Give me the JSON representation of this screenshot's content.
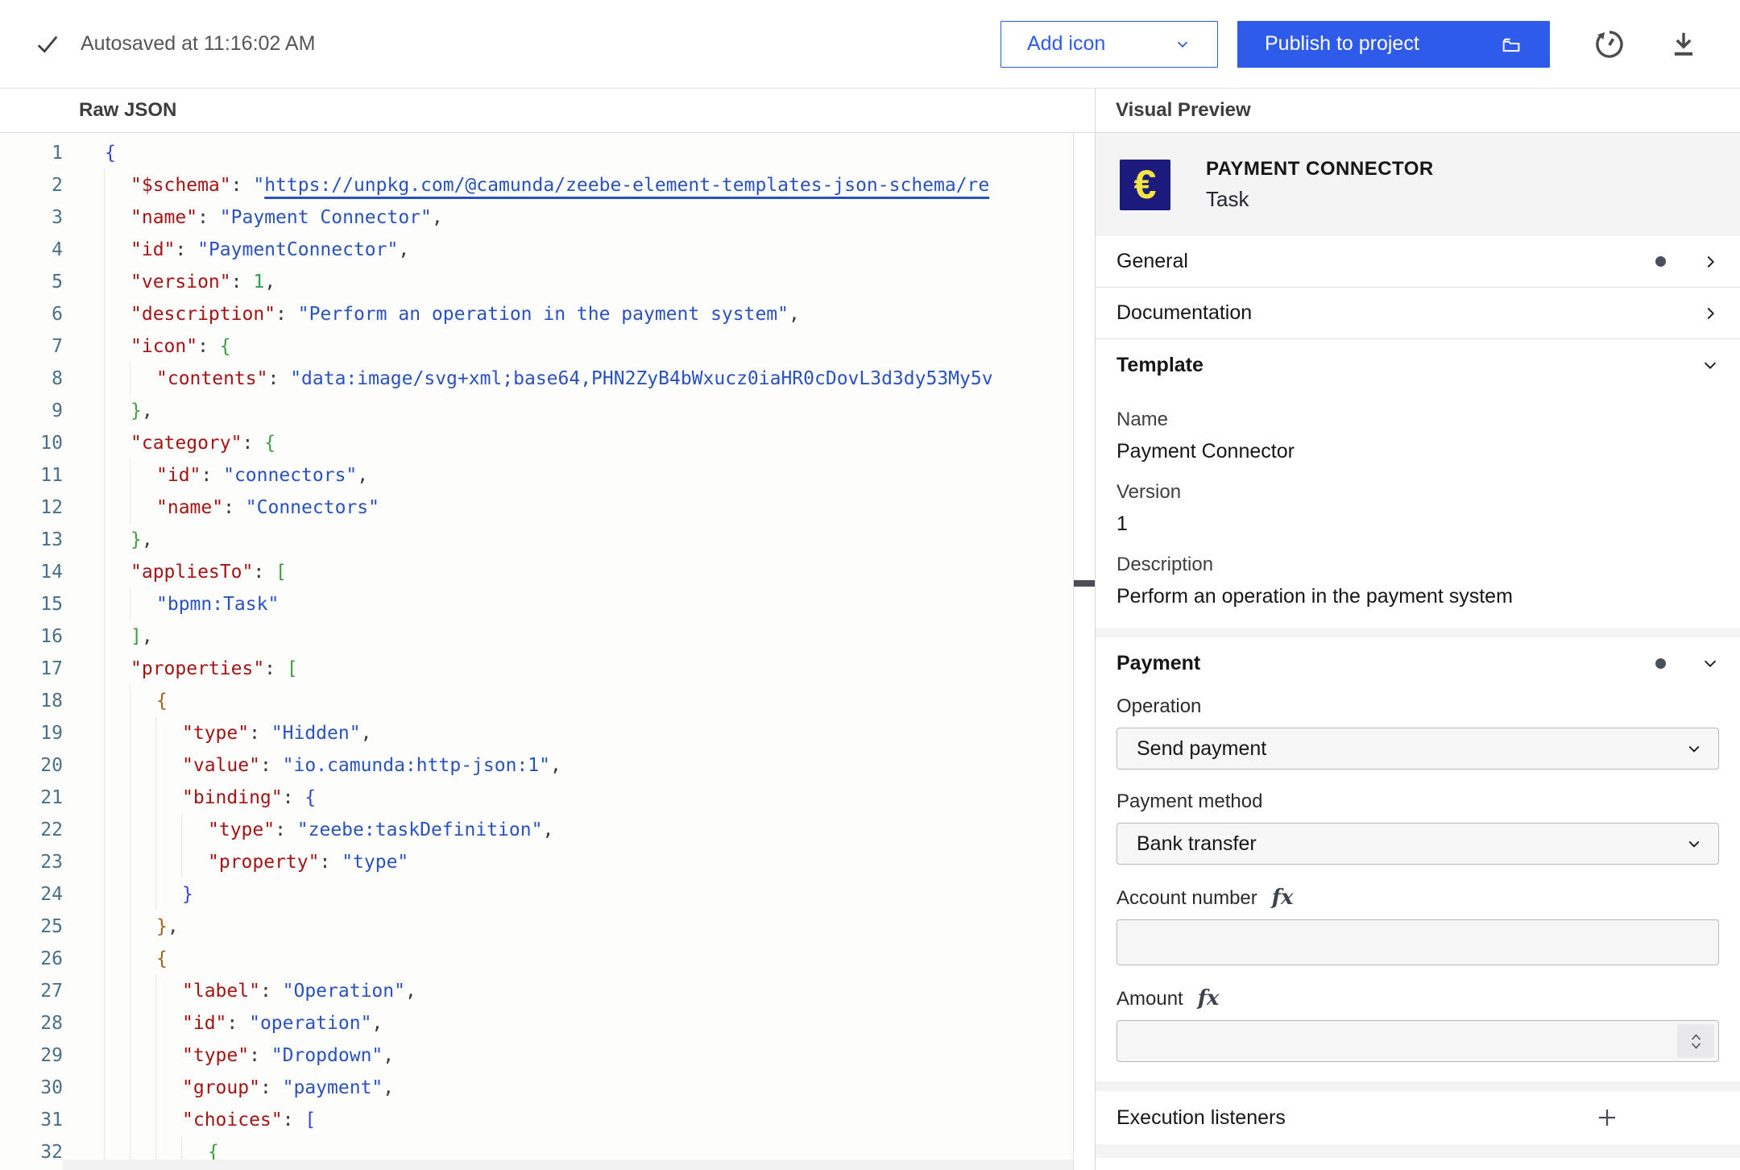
{
  "topbar": {
    "autosave": "Autosaved at 11:16:02 AM",
    "add_icon_label": "Add icon",
    "publish_label": "Publish to project"
  },
  "panels": {
    "left_title": "Raw JSON",
    "right_title": "Visual Preview"
  },
  "editor": {
    "lines": [
      {
        "n": 1,
        "i": 0,
        "t": [
          [
            "b1",
            "{"
          ]
        ]
      },
      {
        "n": 2,
        "i": 1,
        "t": [
          [
            "k",
            "\"$schema\""
          ],
          [
            "p",
            ": "
          ],
          [
            "s",
            "\""
          ],
          [
            "l",
            "https://unpkg.com/@camunda/zeebe-element-templates-json-schema/re"
          ]
        ]
      },
      {
        "n": 3,
        "i": 1,
        "t": [
          [
            "k",
            "\"name\""
          ],
          [
            "p",
            ": "
          ],
          [
            "s",
            "\"Payment Connector\""
          ],
          [
            "p",
            ","
          ]
        ]
      },
      {
        "n": 4,
        "i": 1,
        "t": [
          [
            "k",
            "\"id\""
          ],
          [
            "p",
            ": "
          ],
          [
            "s",
            "\"PaymentConnector\""
          ],
          [
            "p",
            ","
          ]
        ]
      },
      {
        "n": 5,
        "i": 1,
        "t": [
          [
            "k",
            "\"version\""
          ],
          [
            "p",
            ": "
          ],
          [
            "n",
            "1"
          ],
          [
            "p",
            ","
          ]
        ]
      },
      {
        "n": 6,
        "i": 1,
        "t": [
          [
            "k",
            "\"description\""
          ],
          [
            "p",
            ": "
          ],
          [
            "s",
            "\"Perform an operation in the payment system\""
          ],
          [
            "p",
            ","
          ]
        ]
      },
      {
        "n": 7,
        "i": 1,
        "t": [
          [
            "k",
            "\"icon\""
          ],
          [
            "p",
            ": "
          ],
          [
            "b2",
            "{"
          ]
        ]
      },
      {
        "n": 8,
        "i": 2,
        "t": [
          [
            "k",
            "\"contents\""
          ],
          [
            "p",
            ": "
          ],
          [
            "s",
            "\"data:image/svg+xml;base64,PHN2ZyB4bWxucz0iaHR0cDovL3d3dy53My5v"
          ]
        ]
      },
      {
        "n": 9,
        "i": 1,
        "t": [
          [
            "b2",
            "}"
          ],
          [
            "p",
            ","
          ]
        ]
      },
      {
        "n": 10,
        "i": 1,
        "t": [
          [
            "k",
            "\"category\""
          ],
          [
            "p",
            ": "
          ],
          [
            "b2",
            "{"
          ]
        ]
      },
      {
        "n": 11,
        "i": 2,
        "t": [
          [
            "k",
            "\"id\""
          ],
          [
            "p",
            ": "
          ],
          [
            "s",
            "\"connectors\""
          ],
          [
            "p",
            ","
          ]
        ]
      },
      {
        "n": 12,
        "i": 2,
        "t": [
          [
            "k",
            "\"name\""
          ],
          [
            "p",
            ": "
          ],
          [
            "s",
            "\"Connectors\""
          ]
        ]
      },
      {
        "n": 13,
        "i": 1,
        "t": [
          [
            "b2",
            "}"
          ],
          [
            "p",
            ","
          ]
        ]
      },
      {
        "n": 14,
        "i": 1,
        "t": [
          [
            "k",
            "\"appliesTo\""
          ],
          [
            "p",
            ": "
          ],
          [
            "b2",
            "["
          ]
        ]
      },
      {
        "n": 15,
        "i": 2,
        "t": [
          [
            "s",
            "\"bpmn:Task\""
          ]
        ]
      },
      {
        "n": 16,
        "i": 1,
        "t": [
          [
            "b2",
            "]"
          ],
          [
            "p",
            ","
          ]
        ]
      },
      {
        "n": 17,
        "i": 1,
        "t": [
          [
            "k",
            "\"properties\""
          ],
          [
            "p",
            ": "
          ],
          [
            "b2",
            "["
          ]
        ]
      },
      {
        "n": 18,
        "i": 2,
        "t": [
          [
            "b3",
            "{"
          ]
        ]
      },
      {
        "n": 19,
        "i": 3,
        "t": [
          [
            "k",
            "\"type\""
          ],
          [
            "p",
            ": "
          ],
          [
            "s",
            "\"Hidden\""
          ],
          [
            "p",
            ","
          ]
        ]
      },
      {
        "n": 20,
        "i": 3,
        "t": [
          [
            "k",
            "\"value\""
          ],
          [
            "p",
            ": "
          ],
          [
            "s",
            "\"io.camunda:http-json:1\""
          ],
          [
            "p",
            ","
          ]
        ]
      },
      {
        "n": 21,
        "i": 3,
        "t": [
          [
            "k",
            "\"binding\""
          ],
          [
            "p",
            ": "
          ],
          [
            "b1",
            "{"
          ]
        ]
      },
      {
        "n": 22,
        "i": 4,
        "t": [
          [
            "k",
            "\"type\""
          ],
          [
            "p",
            ": "
          ],
          [
            "s",
            "\"zeebe:taskDefinition\""
          ],
          [
            "p",
            ","
          ]
        ]
      },
      {
        "n": 23,
        "i": 4,
        "t": [
          [
            "k",
            "\"property\""
          ],
          [
            "p",
            ": "
          ],
          [
            "s",
            "\"type\""
          ]
        ]
      },
      {
        "n": 24,
        "i": 3,
        "t": [
          [
            "b1",
            "}"
          ]
        ]
      },
      {
        "n": 25,
        "i": 2,
        "t": [
          [
            "b3",
            "}"
          ],
          [
            "p",
            ","
          ]
        ]
      },
      {
        "n": 26,
        "i": 2,
        "t": [
          [
            "b3",
            "{"
          ]
        ]
      },
      {
        "n": 27,
        "i": 3,
        "t": [
          [
            "k",
            "\"label\""
          ],
          [
            "p",
            ": "
          ],
          [
            "s",
            "\"Operation\""
          ],
          [
            "p",
            ","
          ]
        ]
      },
      {
        "n": 28,
        "i": 3,
        "t": [
          [
            "k",
            "\"id\""
          ],
          [
            "p",
            ": "
          ],
          [
            "s",
            "\"operation\""
          ],
          [
            "p",
            ","
          ]
        ]
      },
      {
        "n": 29,
        "i": 3,
        "t": [
          [
            "k",
            "\"type\""
          ],
          [
            "p",
            ": "
          ],
          [
            "s",
            "\"Dropdown\""
          ],
          [
            "p",
            ","
          ]
        ]
      },
      {
        "n": 30,
        "i": 3,
        "t": [
          [
            "k",
            "\"group\""
          ],
          [
            "p",
            ": "
          ],
          [
            "s",
            "\"payment\""
          ],
          [
            "p",
            ","
          ]
        ]
      },
      {
        "n": 31,
        "i": 3,
        "t": [
          [
            "k",
            "\"choices\""
          ],
          [
            "p",
            ": "
          ],
          [
            "b1",
            "["
          ]
        ]
      },
      {
        "n": 32,
        "i": 4,
        "t": [
          [
            "b2",
            "{"
          ]
        ]
      }
    ]
  },
  "preview": {
    "header": {
      "icon_glyph": "€",
      "title": "PAYMENT CONNECTOR",
      "subtitle": "Task"
    },
    "general": {
      "label": "General"
    },
    "documentation": {
      "label": "Documentation"
    },
    "template": {
      "label": "Template",
      "fields": [
        {
          "label": "Name",
          "value": "Payment Connector"
        },
        {
          "label": "Version",
          "value": "1"
        },
        {
          "label": "Description",
          "value": "Perform an operation in the payment system"
        }
      ]
    },
    "payment": {
      "label": "Payment",
      "operation": {
        "label": "Operation",
        "value": "Send payment"
      },
      "payment_method": {
        "label": "Payment method",
        "value": "Bank transfer"
      },
      "account_number": {
        "label": "Account number",
        "fx": "fx",
        "value": ""
      },
      "amount": {
        "label": "Amount",
        "fx": "fx",
        "value": ""
      }
    },
    "execution_listeners": {
      "label": "Execution listeners"
    }
  },
  "colors": {
    "accent_blue": "#2e5bea",
    "icon_navy": "#1b1b7e",
    "icon_yellow": "#f4e543",
    "preview_bg": "#f4f4f4",
    "syntax_key": "#a31515",
    "syntax_string": "#2a52bf",
    "syntax_number": "#2f9e5d",
    "bracket_blue": "#3745d1",
    "bracket_green": "#3f9e3f",
    "bracket_orange": "#a5621d",
    "line_number": "#4a7089"
  }
}
